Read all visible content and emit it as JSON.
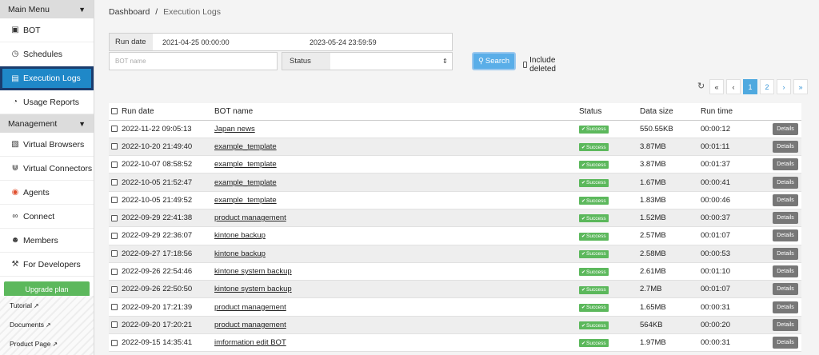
{
  "sidebar": {
    "main_menu": "Main Menu",
    "items": [
      {
        "label": "BOT",
        "icon": "robot-icon"
      },
      {
        "label": "Schedules",
        "icon": "clock-icon"
      },
      {
        "label": "Execution Logs",
        "icon": "file-icon"
      },
      {
        "label": "Usage Reports",
        "icon": "pie-chart-icon"
      }
    ],
    "management": "Management",
    "mgmt_items": [
      {
        "label": "Virtual Browsers",
        "icon": "browser-window-icon"
      },
      {
        "label": "Virtual Connectors",
        "icon": "connector-icon"
      },
      {
        "label": "Agents",
        "icon": "agent-icon"
      },
      {
        "label": "Connect",
        "icon": "link-icon"
      },
      {
        "label": "Members",
        "icon": "users-icon"
      },
      {
        "label": "For Developers",
        "icon": "wrench-icon"
      }
    ],
    "upgrade": "Upgrade plan",
    "links": [
      "Tutorial",
      "Documents",
      "Product Page"
    ]
  },
  "breadcrumb": {
    "home": "Dashboard",
    "sep": "/",
    "current": "Execution Logs"
  },
  "filters": {
    "run_date_label": "Run date",
    "date_from": "2021-04-25 00:00:00",
    "date_to": "2023-05-24 23:59:59",
    "bot_name_placeholder": "BOT name",
    "status_label": "Status",
    "status_value": "",
    "search_label": "Search",
    "include_deleted": "Include deleted"
  },
  "pager": {
    "first": "«",
    "prev": "‹",
    "pages": [
      "1",
      "2"
    ],
    "next": "›",
    "last": "»",
    "current": "1"
  },
  "table": {
    "headers": [
      "Run date",
      "BOT name",
      "Status",
      "Data size",
      "Run time"
    ],
    "details_label": "Details",
    "rows": [
      {
        "date": "2022-11-22 09:05:13",
        "bot": "Japan news",
        "status": "Success",
        "size": "550.55KB",
        "time": "00:00:12"
      },
      {
        "date": "2022-10-20 21:49:40",
        "bot": "example_template",
        "status": "Success",
        "size": "3.87MB",
        "time": "00:01:11"
      },
      {
        "date": "2022-10-07 08:58:52",
        "bot": "example_template",
        "status": "Success",
        "size": "3.87MB",
        "time": "00:01:37"
      },
      {
        "date": "2022-10-05 21:52:47",
        "bot": "example_template",
        "status": "Success",
        "size": "1.67MB",
        "time": "00:00:41"
      },
      {
        "date": "2022-10-05 21:49:52",
        "bot": "example_template",
        "status": "Success",
        "size": "1.83MB",
        "time": "00:00:46"
      },
      {
        "date": "2022-09-29 22:41:38",
        "bot": "product management",
        "status": "Success",
        "size": "1.52MB",
        "time": "00:00:37"
      },
      {
        "date": "2022-09-29 22:36:07",
        "bot": "kintone backup",
        "status": "Success",
        "size": "2.57MB",
        "time": "00:01:07"
      },
      {
        "date": "2022-09-27 17:18:56",
        "bot": "kintone backup",
        "status": "Success",
        "size": "2.58MB",
        "time": "00:00:53"
      },
      {
        "date": "2022-09-26 22:54:46",
        "bot": "kintone system backup",
        "status": "Success",
        "size": "2.61MB",
        "time": "00:01:10"
      },
      {
        "date": "2022-09-26 22:50:50",
        "bot": "kintone system backup",
        "status": "Success",
        "size": "2.7MB",
        "time": "00:01:07"
      },
      {
        "date": "2022-09-20 17:21:39",
        "bot": "product management",
        "status": "Success",
        "size": "1.65MB",
        "time": "00:00:31"
      },
      {
        "date": "2022-09-20 17:20:21",
        "bot": "product management",
        "status": "Success",
        "size": "564KB",
        "time": "00:00:20"
      },
      {
        "date": "2022-09-15 14:35:41",
        "bot": "imformation edit BOT",
        "status": "Success",
        "size": "1.97MB",
        "time": "00:00:31"
      }
    ]
  },
  "colors": {
    "accent": "#1f88c8",
    "success": "#5cb85c",
    "search": "#5aaee8"
  }
}
